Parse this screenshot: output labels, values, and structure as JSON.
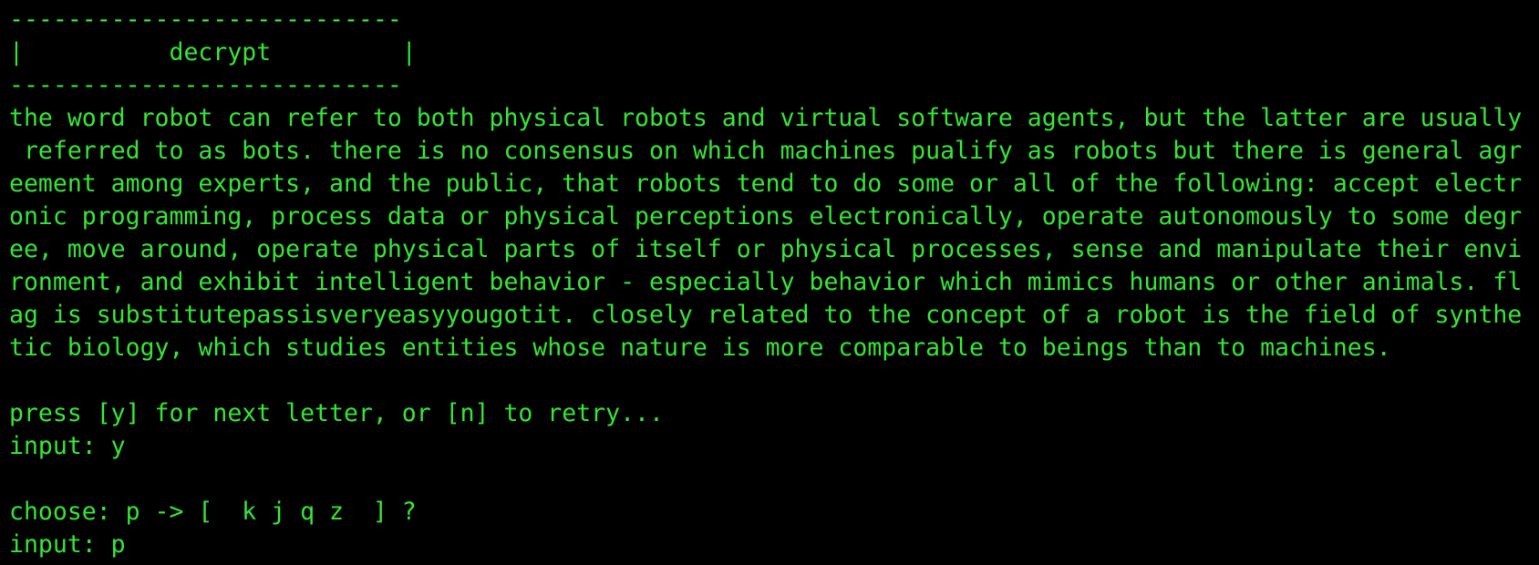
{
  "terminal": {
    "header_rule_top": "---------------------------",
    "header_title_line": "|          decrypt         |",
    "header_rule_bottom": "---------------------------",
    "paragraph_lines": [
      "the word robot can refer to both physical robots and virtual software agents, but the latter are usually",
      " referred to as bots. there is no consensus on which machines pualify as robots but there is general agr",
      "eement among experts, and the public, that robots tend to do some or all of the following: accept electr",
      "onic programming, process data or physical perceptions electronically, operate autonomously to some degr",
      "ee, move around, operate physical parts of itself or physical processes, sense and manipulate their envi",
      "ronment, and exhibit intelligent behavior - especially behavior which mimics humans or other animals. fl",
      "ag is substitutepassisveryeasyyougotit. closely related to the concept of a robot is the field of synthe",
      "tic biology, which studies entities whose nature is more comparable to beings than to machines."
    ],
    "prompt_next": "press [y] for next letter, or [n] to retry...",
    "input_1": "input: y",
    "choose_prompt": "choose: p -> [  k j q z  ] ?",
    "input_2": "input: p"
  },
  "colors": {
    "background": "#000000",
    "text": "#33e633"
  }
}
